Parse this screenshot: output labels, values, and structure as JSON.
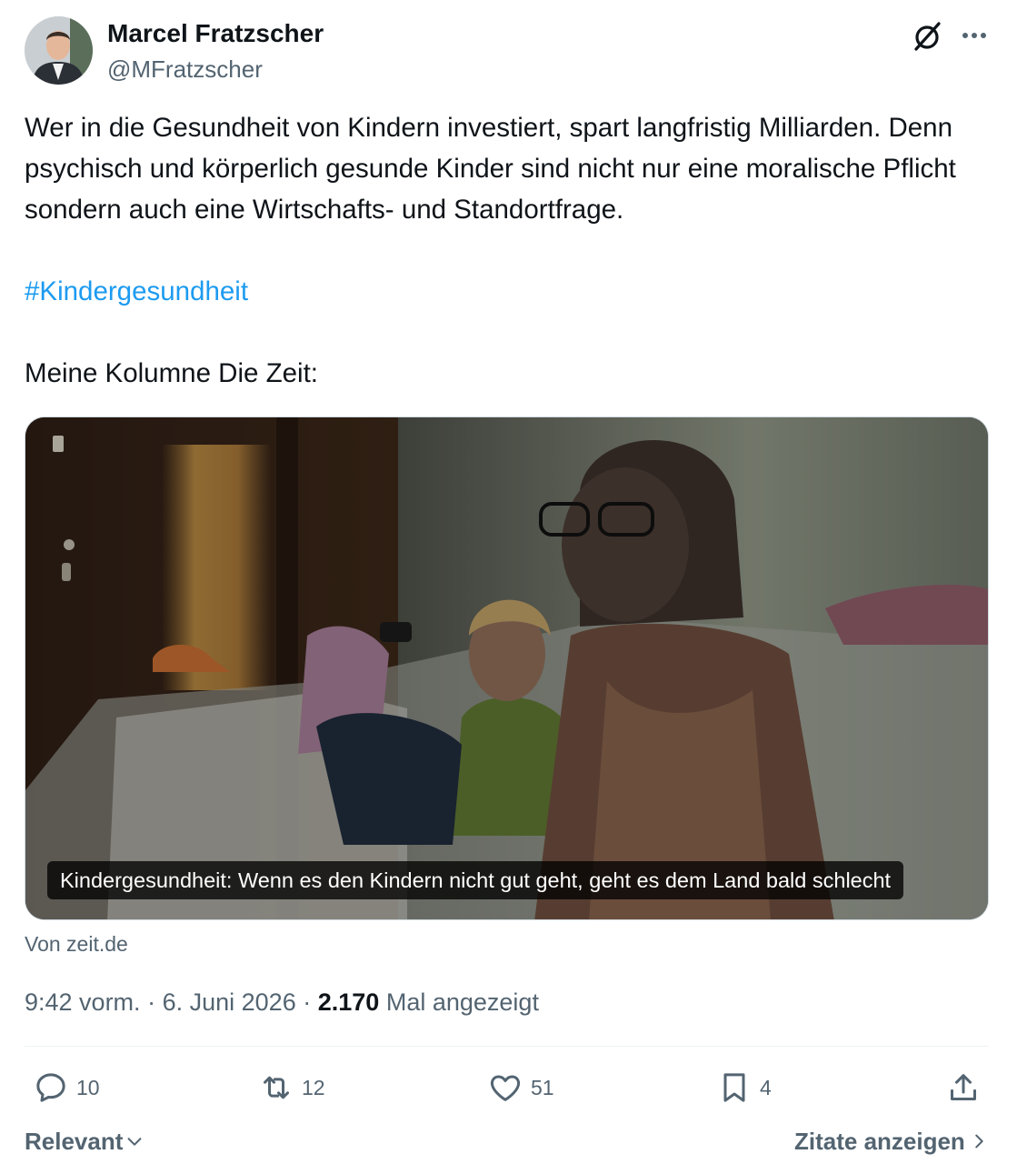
{
  "author": {
    "name": "Marcel Fratzscher",
    "handle": "@MFratzscher",
    "avatar_icon": "avatar"
  },
  "tweet": {
    "text": "Wer in die Gesundheit von Kindern investiert, spart langfristig Milliarden. Denn psychisch und körperlich gesunde Kinder sind nicht nur eine moralische Pflicht sondern auch eine Wirtschafts- und Standortfrage.",
    "hashtag": "#Kindergesundheit",
    "outro": "Meine Kolumne Die Zeit:"
  },
  "card": {
    "caption": "Kindergesundheit: Wenn es den Kindern nicht gut geht, geht es dem Land bald schlecht",
    "source": "Von zeit.de"
  },
  "meta": {
    "time": "9:42 vorm.",
    "date": "6. Juni 2026",
    "views": "2.170",
    "views_label": "Mal angezeigt",
    "separator": "·"
  },
  "actions": {
    "replies": "10",
    "reposts": "12",
    "likes": "51",
    "bookmarks": "4"
  },
  "footer": {
    "sort_label": "Relevant",
    "quotes_label": "Zitate anzeigen"
  },
  "colors": {
    "accent": "#1d9bf0",
    "text": "#0f1419",
    "muted": "#536471"
  }
}
